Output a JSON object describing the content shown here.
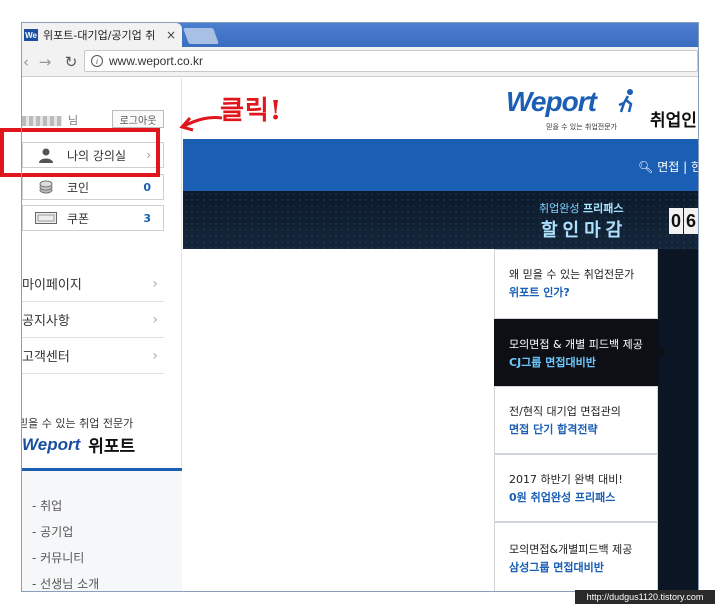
{
  "browser": {
    "tab_title": "위포트-대기업/공기업 취",
    "tab_favicon": "We",
    "tab_close": "×",
    "url": "www.weport.co.kr",
    "icons": [
      "back-icon",
      "forward-icon",
      "reload-icon",
      "info-icon"
    ]
  },
  "sidebar": {
    "user_suffix": "님",
    "logout_label": "로그아웃",
    "my_classroom_label": "나의 강의실",
    "coin_label": "코인",
    "coin_count": "0",
    "coupon_label": "쿠폰",
    "coupon_count": "3",
    "menu": [
      {
        "label": "마이페이지"
      },
      {
        "label": "공지사항"
      },
      {
        "label": "고객센터"
      }
    ],
    "slogan": "믿을 수 있는 취업 전문가",
    "logo_en": "Weport",
    "logo_kr": "위포트",
    "links": [
      "- 취업",
      "- 공기업",
      "- 커뮤니티",
      "- 선생님 소개"
    ]
  },
  "annotation": {
    "click_note": "클릭!"
  },
  "header": {
    "logo": "Weport",
    "logo_tag": "믿을 수 있는 취업전문가",
    "service_label": "취업인",
    "search_text": "면접 | 현"
  },
  "banner": {
    "small_a": "취업완성 ",
    "small_b": "프리패스",
    "big": "할인마감",
    "digits": [
      "0",
      "6"
    ]
  },
  "right_panel": [
    {
      "line1": "왜 믿을 수 있는 취업전문가",
      "line2": "위포트 인가?"
    },
    {
      "line1": "모의면접 & 개별 피드백 제공",
      "line2": "CJ그룹 면접대비반"
    },
    {
      "line1": "전/현직 대기업 면접관의",
      "line2": "면접 단기 합격전략"
    },
    {
      "line1": "2017 하반기 완벽 대비!",
      "line2": "0원 취업완성 프리패스"
    },
    {
      "line1": "모의면접&개별피드백 제공",
      "line2": "삼성그룹 면접대비반"
    }
  ],
  "watermark": "http://dudgus1120.tistory.com",
  "colors": {
    "accent_blue": "#1a5fb4",
    "highlight_red": "#e0161c",
    "banner_dark": "#0c1a2a"
  }
}
